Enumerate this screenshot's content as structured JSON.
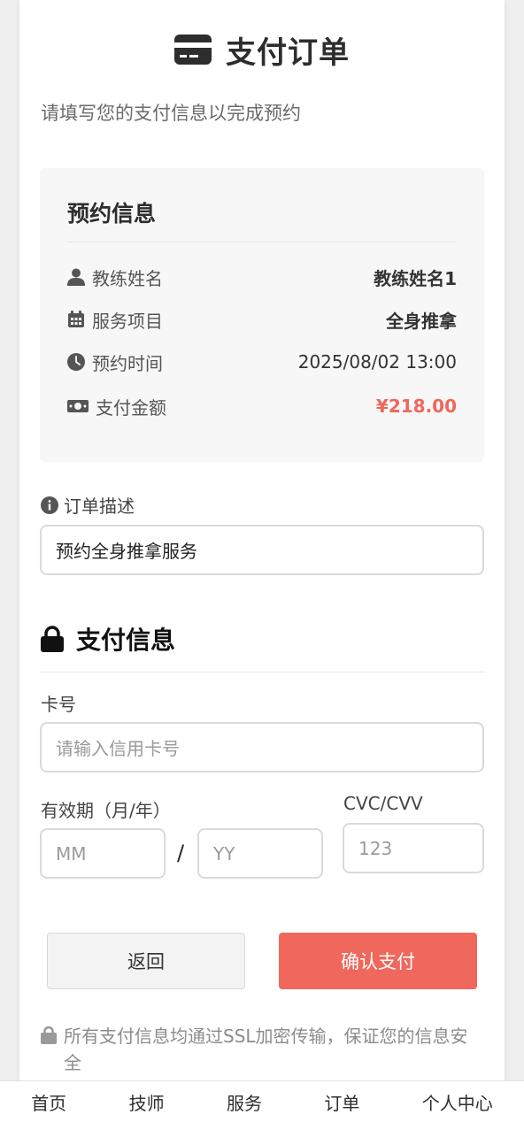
{
  "page": {
    "title": "支付订单",
    "subtitle": "请填写您的支付信息以完成预约"
  },
  "booking_info": {
    "title": "预约信息",
    "rows": [
      {
        "icon": "user-icon",
        "label": "教练姓名",
        "value": "教练姓名1"
      },
      {
        "icon": "calendar-icon",
        "label": "服务项目",
        "value": "全身推拿"
      },
      {
        "icon": "clock-icon",
        "label": "预约时间",
        "value": "2025/08/02 13:00"
      },
      {
        "icon": "money-icon",
        "label": "支付金额",
        "value": "¥218.00"
      }
    ]
  },
  "order_description": {
    "label": "订单描述",
    "value": "预约全身推拿服务"
  },
  "payment_info": {
    "title": "支付信息",
    "card_number_label": "卡号",
    "card_number_placeholder": "请输入信用卡号",
    "expiry_label": "有效期（月/年）",
    "month_placeholder": "MM",
    "separator": "/",
    "year_placeholder": "YY",
    "cvc_label": "CVC/CVV",
    "cvc_placeholder": "123"
  },
  "buttons": {
    "back": "返回",
    "confirm": "确认支付"
  },
  "security_note": "所有支付信息均通过SSL加密传输，保证您的信息安全",
  "bottom_nav": [
    "首页",
    "技师",
    "服务",
    "订单",
    "个人中心"
  ],
  "colors": {
    "accent": "#f0675c",
    "info_box_bg": "#f7f7f7"
  }
}
